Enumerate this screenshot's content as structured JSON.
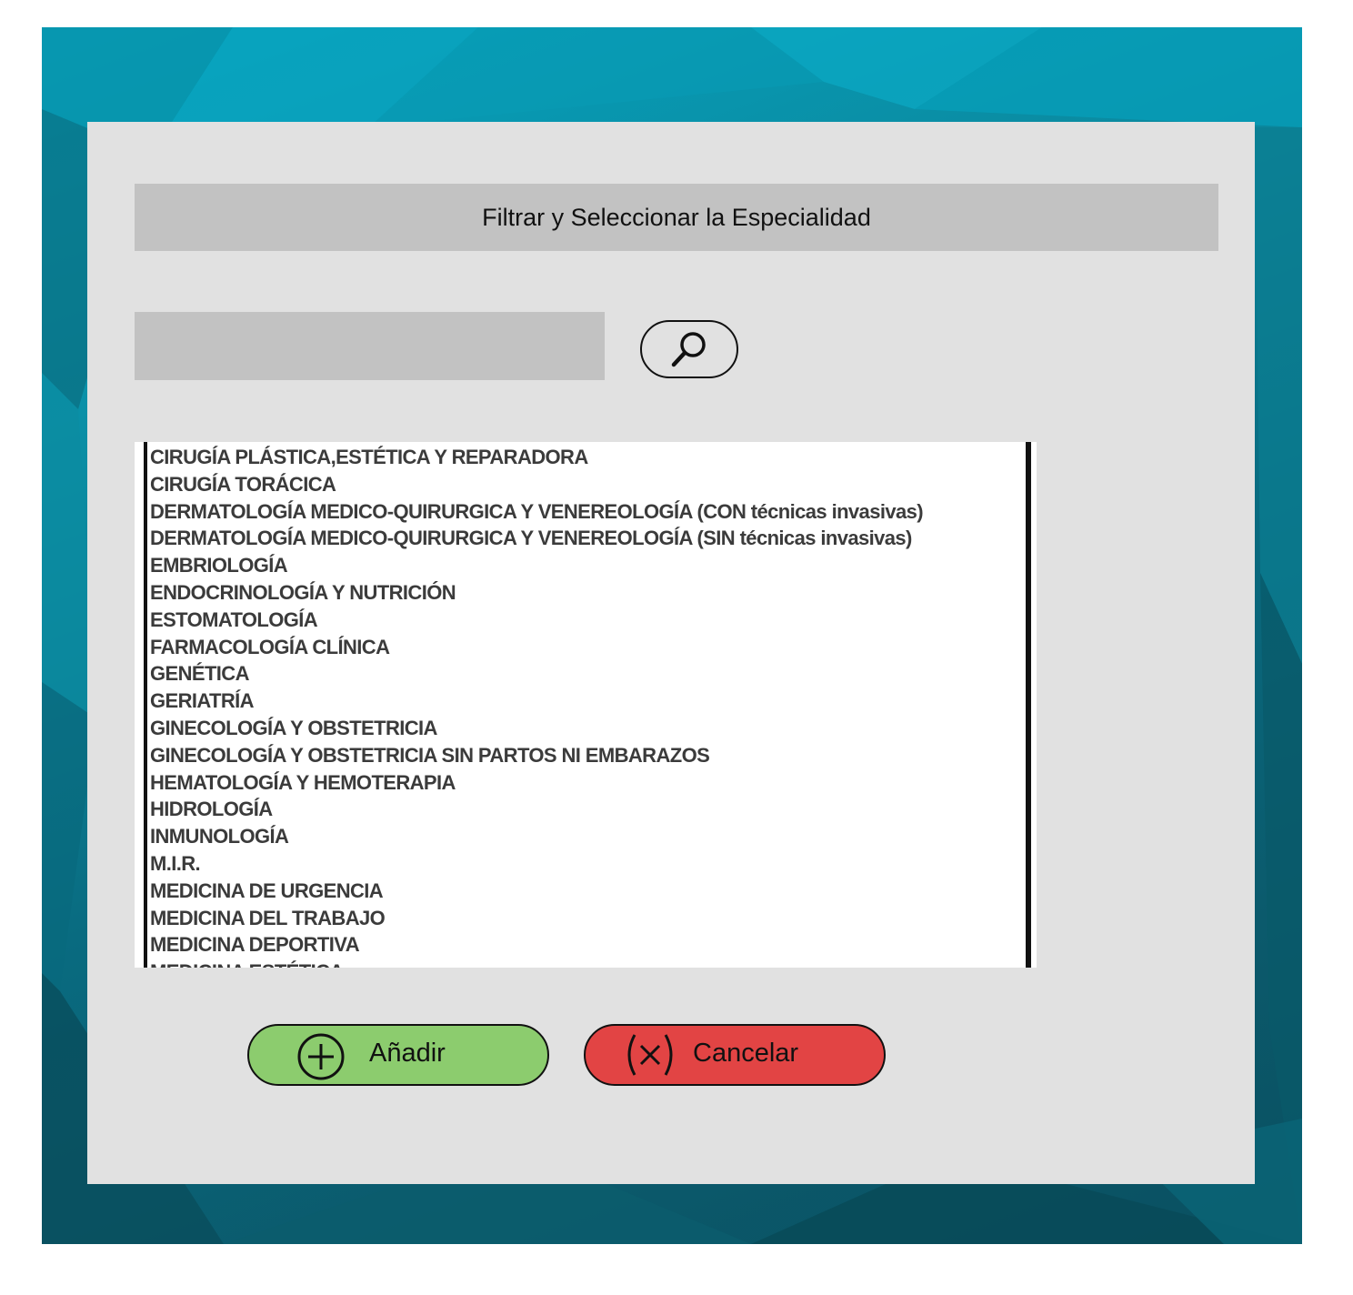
{
  "dialog": {
    "title": "Filtrar y Seleccionar la Especialidad"
  },
  "search": {
    "value": "",
    "button_icon": "search-icon"
  },
  "specialties": [
    "CIRUGÍA PLÁSTICA,ESTÉTICA Y REPARADORA",
    "CIRUGÍA TORÁCICA",
    "DERMATOLOGÍA MEDICO-QUIRURGICA Y VENEREOLOGÍA (CON técnicas invasivas)",
    "DERMATOLOGÍA MEDICO-QUIRURGICA Y VENEREOLOGÍA (SIN técnicas invasivas)",
    "EMBRIOLOGÍA",
    "ENDOCRINOLOGÍA Y NUTRICIÓN",
    "ESTOMATOLOGÍA",
    "FARMACOLOGÍA CLÍNICA",
    "GENÉTICA",
    "GERIATRÍA",
    "GINECOLOGÍA Y OBSTETRICIA",
    "GINECOLOGÍA Y OBSTETRICIA  SIN PARTOS NI EMBARAZOS",
    "HEMATOLOGÍA Y HEMOTERAPIA",
    "HIDROLOGÍA",
    "INMUNOLOGÍA",
    "M.I.R.",
    "MEDICINA DE URGENCIA",
    "MEDICINA DEL TRABAJO",
    "MEDICINA DEPORTIVA",
    "MEDICINA ESTÉTICA"
  ],
  "buttons": {
    "add_label": "Añadir",
    "add_icon": "plus-circle-icon",
    "cancel_label": "Cancelar",
    "cancel_icon": "close-circle-icon"
  },
  "colors": {
    "backdrop": "#0a8aa2",
    "dialog": "#e1e1e1",
    "bar": "#c2c2c2",
    "add_button": "#8ccc6e",
    "cancel_button": "#e24444"
  }
}
